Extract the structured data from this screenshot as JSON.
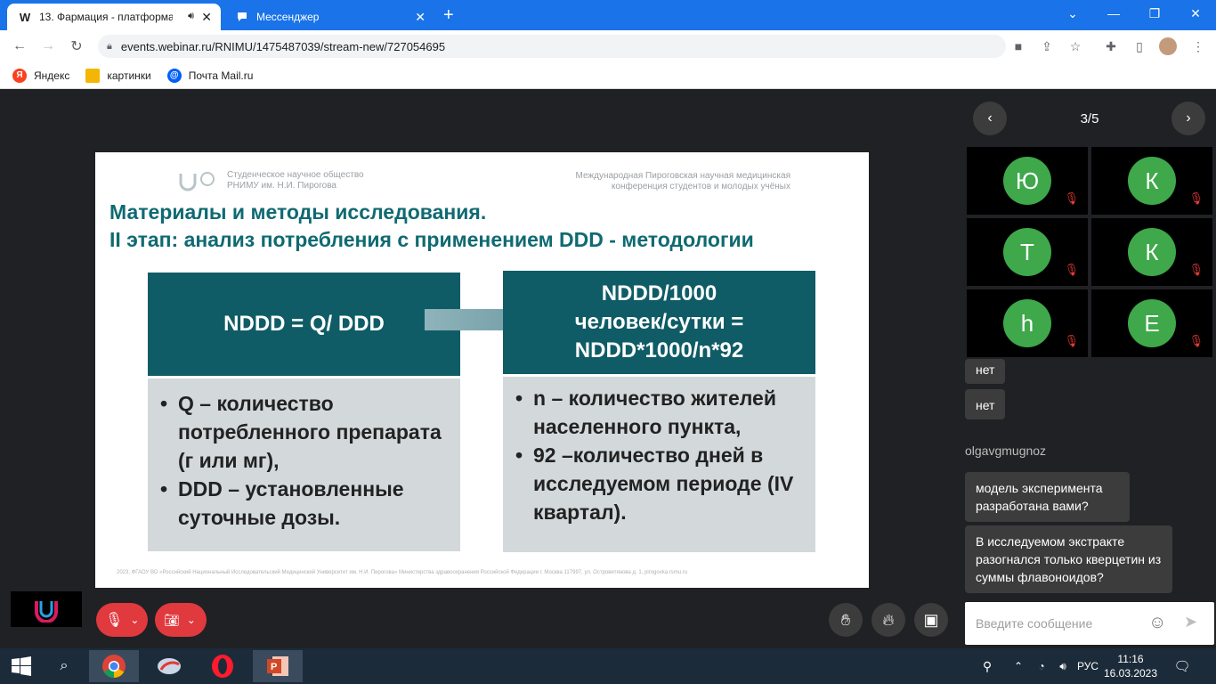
{
  "browser": {
    "tabs": [
      {
        "icon": "W",
        "title": "13. Фармация - платформа"
      },
      {
        "icon": "messenger",
        "title": "Мессенджер"
      }
    ],
    "url": "events.webinar.ru/RNIMU/1475487039/stream-new/727054695",
    "bookmarks": [
      "Яндекс",
      "картинки",
      "Почта Mail.ru"
    ]
  },
  "slide": {
    "org_left_1": "Студенческое научное общество",
    "org_left_2": "РНИМУ им. Н.И. Пирогова",
    "org_right_1": "Международная Пироговская научная медицинская",
    "org_right_2": "конференция студентов и молодых учёных",
    "title_1": "Материалы и методы исследования.",
    "title_2": "II этап: анализ потребления с применением DDD - методологии",
    "left_head": "NDDD = Q/ DDD",
    "left_items": [
      "Q – количество потребленного препарата (г или мг),",
      "DDD – установленные суточные дозы."
    ],
    "right_head_1": "NDDD/1000",
    "right_head_2": "человек/сутки =",
    "right_head_3": "NDDD*1000/n*92",
    "right_items": [
      "n – количество жителей населенного пункта,",
      "92 –количество дней в исследуемом периоде (IV квартал)."
    ],
    "footer": "2023, ФГАОУ ВО «Российский Национальный Исследовательский Медицинский Университет им. Н.И. Пирогова» Министерства здравоохранения Российской Федерации г. Москва 117997, ул. Островитянова д. 1, pirogovka.rsmu.ru"
  },
  "pager": {
    "label": "3/5"
  },
  "participants": [
    "Ю",
    "К",
    "Т",
    "К",
    "h",
    "Е"
  ],
  "chat": {
    "messages": [
      {
        "text": "нет"
      },
      {
        "text": "нет"
      }
    ],
    "author": "olgavgmugnoz",
    "author_messages": [
      "модель эксперимента разработана вами?",
      "В исследуемом экстракте разогнался только кверцетин из суммы флавоноидов?"
    ],
    "input_placeholder": "Введите сообщение"
  },
  "taskbar": {
    "lang": "РУС",
    "time": "11:16",
    "date": "16.03.2023"
  },
  "colors": {
    "accent": "#1a73e8",
    "slide_teal": "#0f5c66",
    "danger": "#e0393e",
    "avatar": "#3ea84b"
  }
}
